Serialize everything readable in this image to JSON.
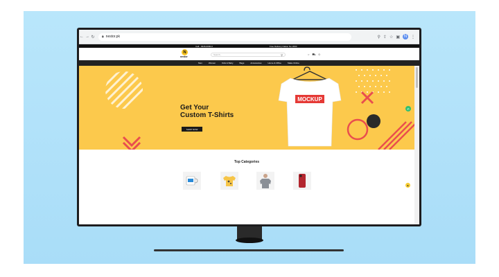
{
  "browser": {
    "url": "nestor.pk",
    "profile_initial": "N",
    "icons": [
      "back-icon",
      "forward-icon",
      "reload-icon",
      "lock-icon",
      "zoom-icon",
      "share-icon",
      "star-icon",
      "extensions-icon",
      "menu-icon"
    ]
  },
  "infobar": {
    "call": "Call - 0346-0000-0",
    "shipping": "Free Delivery Nation No 2000"
  },
  "header": {
    "logo_letter": "N",
    "logo_text": "nestor",
    "search_placeholder": "Search..."
  },
  "nav": {
    "items": [
      "Men",
      "Women",
      "Kids & Baby",
      "Bags",
      "Accessories",
      "Home & Office",
      "Make Online"
    ]
  },
  "hero": {
    "title_line1": "Get Your",
    "title_line2": "Custom T-Shirts",
    "button_label": "SHOP NOW",
    "shirt_text": "MOCKUP",
    "colors": {
      "bg": "#fcc94c",
      "accent": "#e94e4e",
      "dark": "#1a1a1a"
    }
  },
  "categories": {
    "title": "Top Categories",
    "items": [
      "mug",
      "kids-tshirt",
      "men-tshirt",
      "phone-case"
    ]
  },
  "colors": {
    "backdrop": "#b9e6fb",
    "chat": "#2fbf71",
    "scroll_top": "#f6cc32"
  }
}
